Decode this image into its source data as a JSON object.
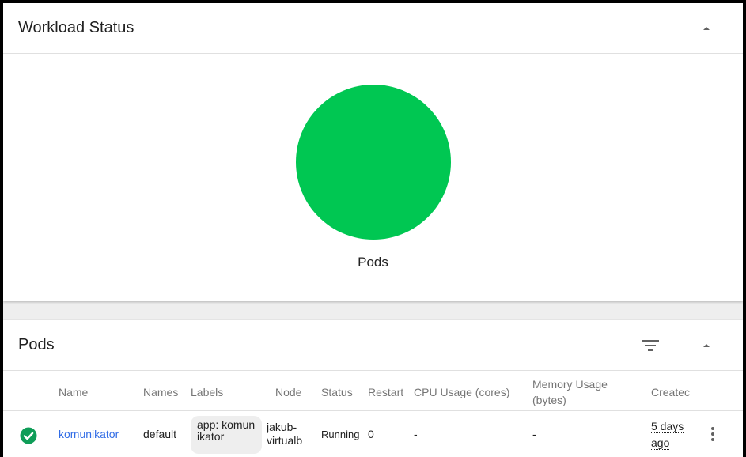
{
  "workload_status": {
    "title": "Workload Status",
    "pie_label": "Pods",
    "pie_color": "#00c752",
    "collapse_icon": "chevron-up-icon"
  },
  "pods": {
    "title": "Pods",
    "filter_icon": "filter-icon",
    "collapse_icon": "chevron-up-icon",
    "columns": {
      "name": "Name",
      "namespace": "Names",
      "labels": "Labels",
      "node": "Node",
      "status": "Status",
      "restarts": "Restart",
      "cpu": "CPU Usage (cores)",
      "memory_line1": "Memory Usage",
      "memory_line2": "(bytes)",
      "created": "Createc"
    },
    "rows": [
      {
        "status_icon": "check-circle-icon",
        "status_color": "#0f9d58",
        "name": "komunikator",
        "namespace": "default",
        "label": "app: komunikator",
        "node_line1": "jakub-",
        "node_line2": "virtualb",
        "status": "Running",
        "restarts": "0",
        "cpu": "-",
        "memory": "-",
        "created_line1": "5 days",
        "created_line2": "ago",
        "more_icon": "more-vert-icon"
      }
    ]
  }
}
